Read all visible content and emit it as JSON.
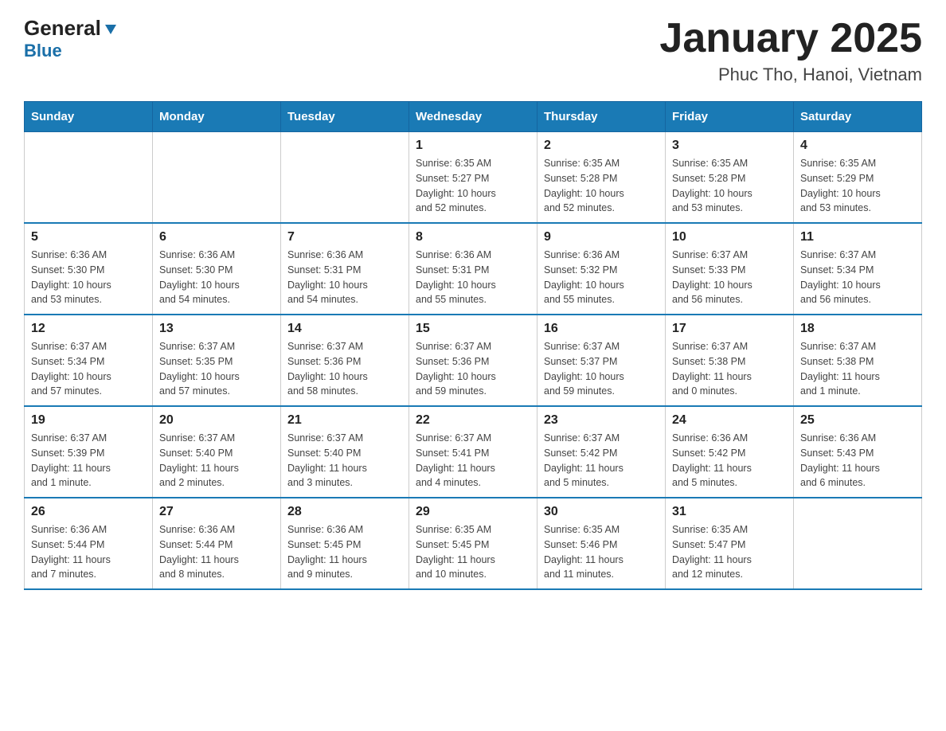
{
  "logo": {
    "line1": "General",
    "line2": "Blue"
  },
  "title": "January 2025",
  "subtitle": "Phuc Tho, Hanoi, Vietnam",
  "days_of_week": [
    "Sunday",
    "Monday",
    "Tuesday",
    "Wednesday",
    "Thursday",
    "Friday",
    "Saturday"
  ],
  "weeks": [
    [
      {
        "day": "",
        "info": ""
      },
      {
        "day": "",
        "info": ""
      },
      {
        "day": "",
        "info": ""
      },
      {
        "day": "1",
        "info": "Sunrise: 6:35 AM\nSunset: 5:27 PM\nDaylight: 10 hours\nand 52 minutes."
      },
      {
        "day": "2",
        "info": "Sunrise: 6:35 AM\nSunset: 5:28 PM\nDaylight: 10 hours\nand 52 minutes."
      },
      {
        "day": "3",
        "info": "Sunrise: 6:35 AM\nSunset: 5:28 PM\nDaylight: 10 hours\nand 53 minutes."
      },
      {
        "day": "4",
        "info": "Sunrise: 6:35 AM\nSunset: 5:29 PM\nDaylight: 10 hours\nand 53 minutes."
      }
    ],
    [
      {
        "day": "5",
        "info": "Sunrise: 6:36 AM\nSunset: 5:30 PM\nDaylight: 10 hours\nand 53 minutes."
      },
      {
        "day": "6",
        "info": "Sunrise: 6:36 AM\nSunset: 5:30 PM\nDaylight: 10 hours\nand 54 minutes."
      },
      {
        "day": "7",
        "info": "Sunrise: 6:36 AM\nSunset: 5:31 PM\nDaylight: 10 hours\nand 54 minutes."
      },
      {
        "day": "8",
        "info": "Sunrise: 6:36 AM\nSunset: 5:31 PM\nDaylight: 10 hours\nand 55 minutes."
      },
      {
        "day": "9",
        "info": "Sunrise: 6:36 AM\nSunset: 5:32 PM\nDaylight: 10 hours\nand 55 minutes."
      },
      {
        "day": "10",
        "info": "Sunrise: 6:37 AM\nSunset: 5:33 PM\nDaylight: 10 hours\nand 56 minutes."
      },
      {
        "day": "11",
        "info": "Sunrise: 6:37 AM\nSunset: 5:34 PM\nDaylight: 10 hours\nand 56 minutes."
      }
    ],
    [
      {
        "day": "12",
        "info": "Sunrise: 6:37 AM\nSunset: 5:34 PM\nDaylight: 10 hours\nand 57 minutes."
      },
      {
        "day": "13",
        "info": "Sunrise: 6:37 AM\nSunset: 5:35 PM\nDaylight: 10 hours\nand 57 minutes."
      },
      {
        "day": "14",
        "info": "Sunrise: 6:37 AM\nSunset: 5:36 PM\nDaylight: 10 hours\nand 58 minutes."
      },
      {
        "day": "15",
        "info": "Sunrise: 6:37 AM\nSunset: 5:36 PM\nDaylight: 10 hours\nand 59 minutes."
      },
      {
        "day": "16",
        "info": "Sunrise: 6:37 AM\nSunset: 5:37 PM\nDaylight: 10 hours\nand 59 minutes."
      },
      {
        "day": "17",
        "info": "Sunrise: 6:37 AM\nSunset: 5:38 PM\nDaylight: 11 hours\nand 0 minutes."
      },
      {
        "day": "18",
        "info": "Sunrise: 6:37 AM\nSunset: 5:38 PM\nDaylight: 11 hours\nand 1 minute."
      }
    ],
    [
      {
        "day": "19",
        "info": "Sunrise: 6:37 AM\nSunset: 5:39 PM\nDaylight: 11 hours\nand 1 minute."
      },
      {
        "day": "20",
        "info": "Sunrise: 6:37 AM\nSunset: 5:40 PM\nDaylight: 11 hours\nand 2 minutes."
      },
      {
        "day": "21",
        "info": "Sunrise: 6:37 AM\nSunset: 5:40 PM\nDaylight: 11 hours\nand 3 minutes."
      },
      {
        "day": "22",
        "info": "Sunrise: 6:37 AM\nSunset: 5:41 PM\nDaylight: 11 hours\nand 4 minutes."
      },
      {
        "day": "23",
        "info": "Sunrise: 6:37 AM\nSunset: 5:42 PM\nDaylight: 11 hours\nand 5 minutes."
      },
      {
        "day": "24",
        "info": "Sunrise: 6:36 AM\nSunset: 5:42 PM\nDaylight: 11 hours\nand 5 minutes."
      },
      {
        "day": "25",
        "info": "Sunrise: 6:36 AM\nSunset: 5:43 PM\nDaylight: 11 hours\nand 6 minutes."
      }
    ],
    [
      {
        "day": "26",
        "info": "Sunrise: 6:36 AM\nSunset: 5:44 PM\nDaylight: 11 hours\nand 7 minutes."
      },
      {
        "day": "27",
        "info": "Sunrise: 6:36 AM\nSunset: 5:44 PM\nDaylight: 11 hours\nand 8 minutes."
      },
      {
        "day": "28",
        "info": "Sunrise: 6:36 AM\nSunset: 5:45 PM\nDaylight: 11 hours\nand 9 minutes."
      },
      {
        "day": "29",
        "info": "Sunrise: 6:35 AM\nSunset: 5:45 PM\nDaylight: 11 hours\nand 10 minutes."
      },
      {
        "day": "30",
        "info": "Sunrise: 6:35 AM\nSunset: 5:46 PM\nDaylight: 11 hours\nand 11 minutes."
      },
      {
        "day": "31",
        "info": "Sunrise: 6:35 AM\nSunset: 5:47 PM\nDaylight: 11 hours\nand 12 minutes."
      },
      {
        "day": "",
        "info": ""
      }
    ]
  ]
}
